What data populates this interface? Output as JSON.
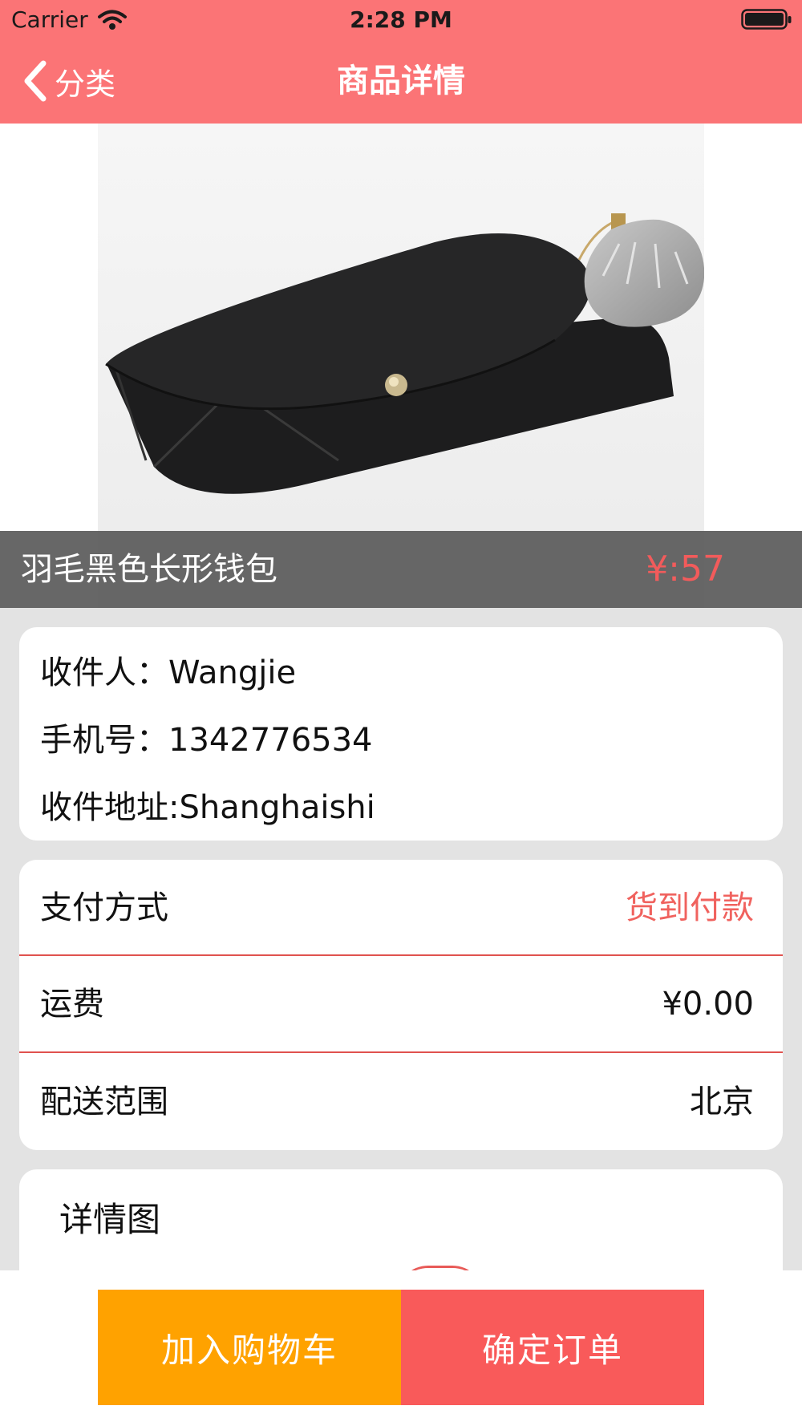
{
  "status_bar": {
    "carrier": "Carrier",
    "time": "2:28 PM"
  },
  "nav": {
    "back_label": "分类",
    "title": "商品详情"
  },
  "product": {
    "name": "羽毛黑色长形钱包",
    "price": "¥:57",
    "image_icon": "wallet-icon"
  },
  "address": {
    "recipient": "收件人：Wangjie",
    "phone": "手机号：1342776534",
    "location": "收件地址:Shanghaishi"
  },
  "payment": {
    "rows": [
      {
        "label": "支付方式",
        "value": "货到付款"
      },
      {
        "label": "运费",
        "value": "¥0.00"
      },
      {
        "label": "配送范围",
        "value": "北京"
      }
    ]
  },
  "detail": {
    "title": "详情图"
  },
  "actions": {
    "add_to_cart": "加入购物车",
    "confirm_order": "确定订单"
  },
  "colors": {
    "header": "#fb7476",
    "accent": "#f0625e",
    "cart_button": "#ffa200",
    "confirm_button": "#f95a5a"
  }
}
